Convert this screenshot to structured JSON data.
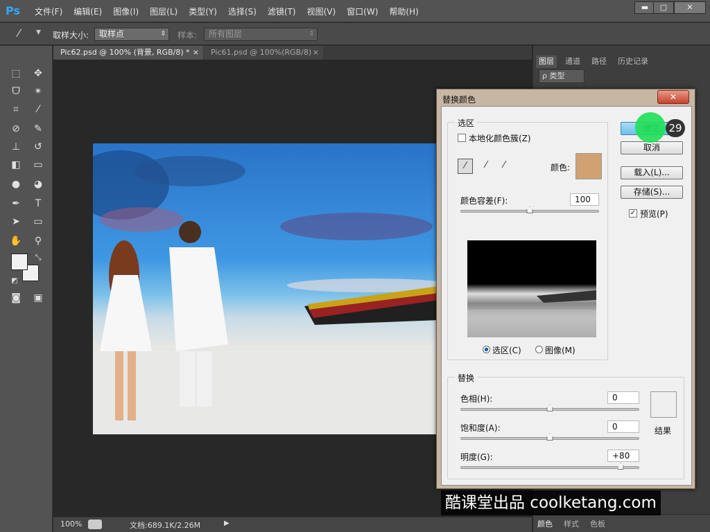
{
  "app": {
    "logo": "Ps"
  },
  "menu": [
    "文件(F)",
    "编辑(E)",
    "图像(I)",
    "图层(L)",
    "类型(Y)",
    "选择(S)",
    "滤镜(T)",
    "视图(V)",
    "窗口(W)",
    "帮助(H)"
  ],
  "window_controls": {
    "minimize": "▬",
    "maximize": "▢",
    "close": "✕"
  },
  "options": {
    "sample_size_label": "取样大小:",
    "sample_size_value": "取样点",
    "sample_label": "样本:",
    "sample_value": "所有图层"
  },
  "tabs": [
    {
      "title": "Pic62.psd @ 100% (背景, RGB/8) *",
      "close": "×",
      "active": true
    },
    {
      "title": "Pic61.psd @ 100%(RGB/8)",
      "close": "×",
      "active": false
    }
  ],
  "status": {
    "zoom": "100%",
    "doc": "文档:689.1K/2.26M"
  },
  "right_panel": {
    "tabs": [
      "图层",
      "通道",
      "路径",
      "历史记录"
    ],
    "filter_label": "ρ 类型",
    "bottom_tabs": [
      "颜色",
      "样式",
      "色板"
    ]
  },
  "dialog": {
    "title": "替换颜色",
    "close": "✕",
    "selection_group": "选区",
    "localized_clusters": "本地化颜色簇(Z)",
    "localized_checked": false,
    "color_label": "颜色:",
    "color_swatch": "#d0a272",
    "fuzziness_label": "颜色容差(F):",
    "fuzziness_value": "100",
    "fuzziness_level": 0.5,
    "radio_selection": "选区(C)",
    "radio_image": "图像(M)",
    "selected_radio": "selection",
    "replace_group": "替换",
    "hue_label": "色相(H):",
    "hue_value": "0",
    "hue_level": 0.5,
    "saturation_label": "饱和度(A):",
    "saturation_value": "0",
    "saturation_level": 0.5,
    "lightness_label": "明度(G):",
    "lightness_value": "+80",
    "lightness_level": 0.9,
    "result_label": "结果",
    "result_color": "#efefef",
    "buttons": {
      "ok": "确定",
      "cancel": "取消",
      "load": "载入(L)...",
      "save": "存储(S)..."
    },
    "preview_label": "预览(P)",
    "preview_checked": true
  },
  "overlay": {
    "step": "29",
    "watermark": "酷课堂出品 coolketang.com"
  }
}
